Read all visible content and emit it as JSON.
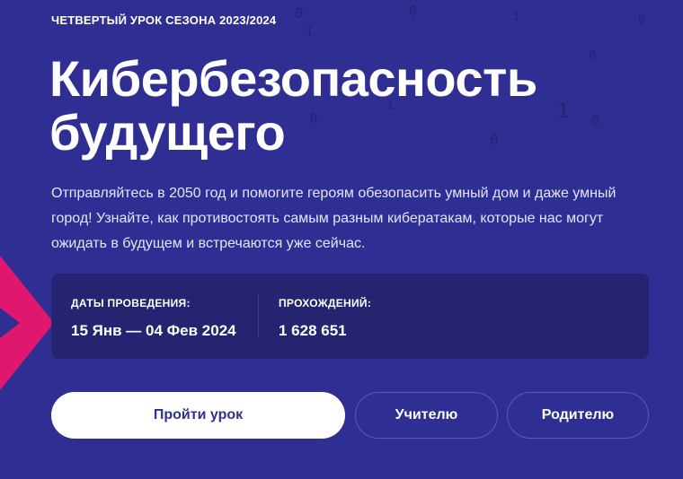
{
  "hero": {
    "eyebrow": "ЧЕТВЕРТЫЙ УРОК СЕЗОНА 2023/2024",
    "title": "Кибербезопасность будущего",
    "description": "Отправляйтесь в 2050 год и помогите героям обезопасить умный дом и даже умный город! Узнайте, как противостоять самым разным кибератакам, которые нас могут ожидать в будущем и встречаются уже сейчас."
  },
  "stats": {
    "dates_label": "ДАТЫ ПРОВЕДЕНИЯ:",
    "dates_value": "15 Янв — 04 Фев 2024",
    "count_label": "ПРОХОЖДЕНИЙ:",
    "count_value": "1 628 651"
  },
  "buttons": {
    "start": "Пройти урок",
    "teacher": "Учителю",
    "parent": "Родителю"
  },
  "colors": {
    "background": "#2f2f93",
    "panel": "#262471",
    "accent_pink": "#e0176f",
    "button_text": "#2f2f93"
  },
  "decor": {
    "digits": [
      "0",
      "1",
      "0",
      "1",
      "0",
      "0",
      "1",
      "0",
      "1",
      "0",
      "0"
    ]
  }
}
